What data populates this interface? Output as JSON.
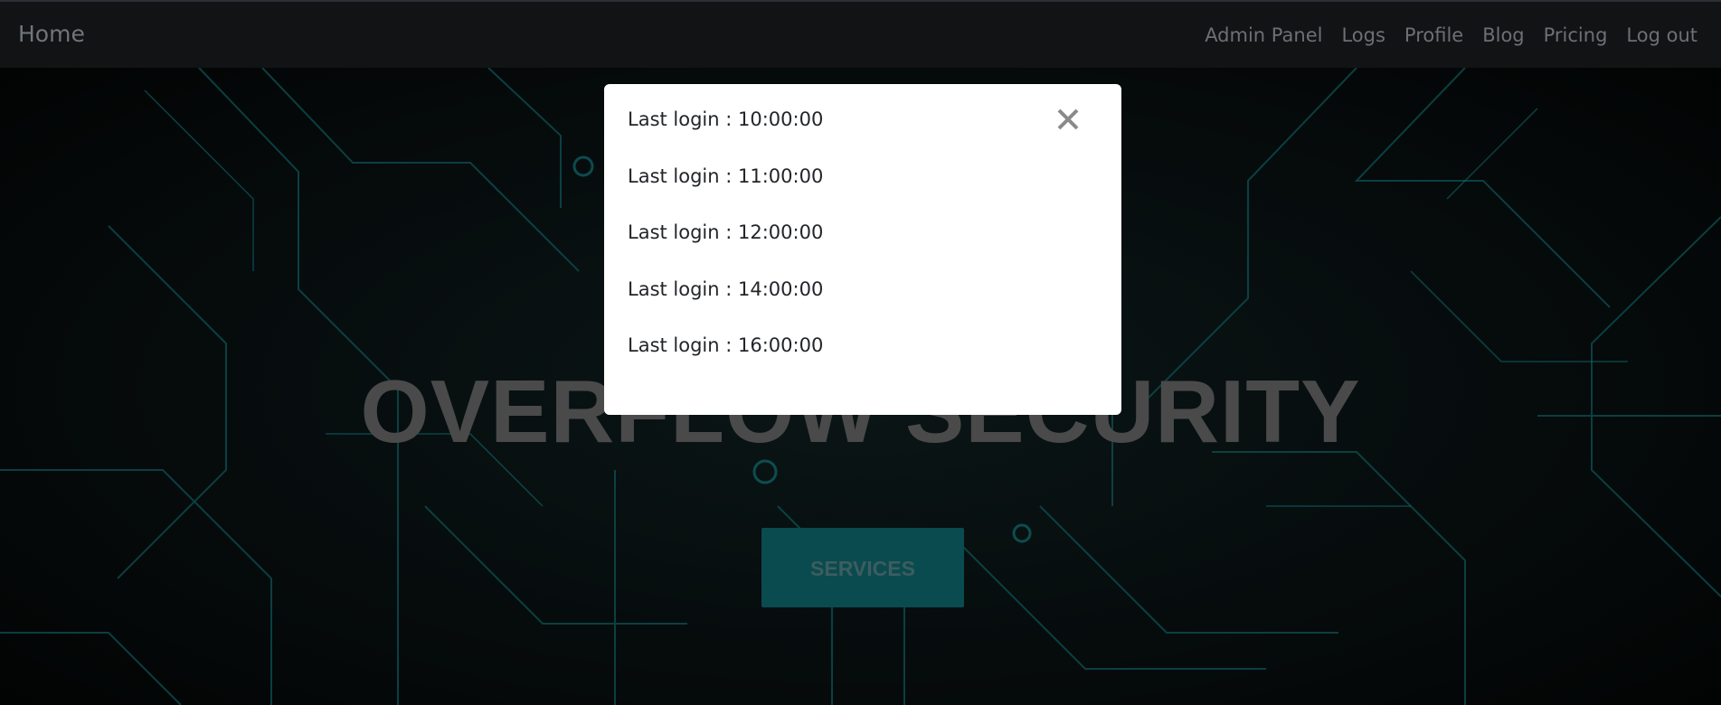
{
  "navbar": {
    "brand": "Home",
    "links": [
      "Admin Panel",
      "Logs",
      "Profile",
      "Blog",
      "Pricing",
      "Log out"
    ]
  },
  "hero": {
    "title": "OVERFLOW SECURITY",
    "button_label": "SERVICES"
  },
  "modal": {
    "close_icon": "close-icon",
    "logins": [
      "Last login : 10:00:00",
      "Last login : 11:00:00",
      "Last login : 12:00:00",
      "Last login : 14:00:00",
      "Last login : 16:00:00"
    ]
  },
  "colors": {
    "navbar_bg": "#111315",
    "circuit_accent": "#0e6b6e",
    "button_bg": "#0a4b4f",
    "modal_bg": "#ffffff"
  }
}
